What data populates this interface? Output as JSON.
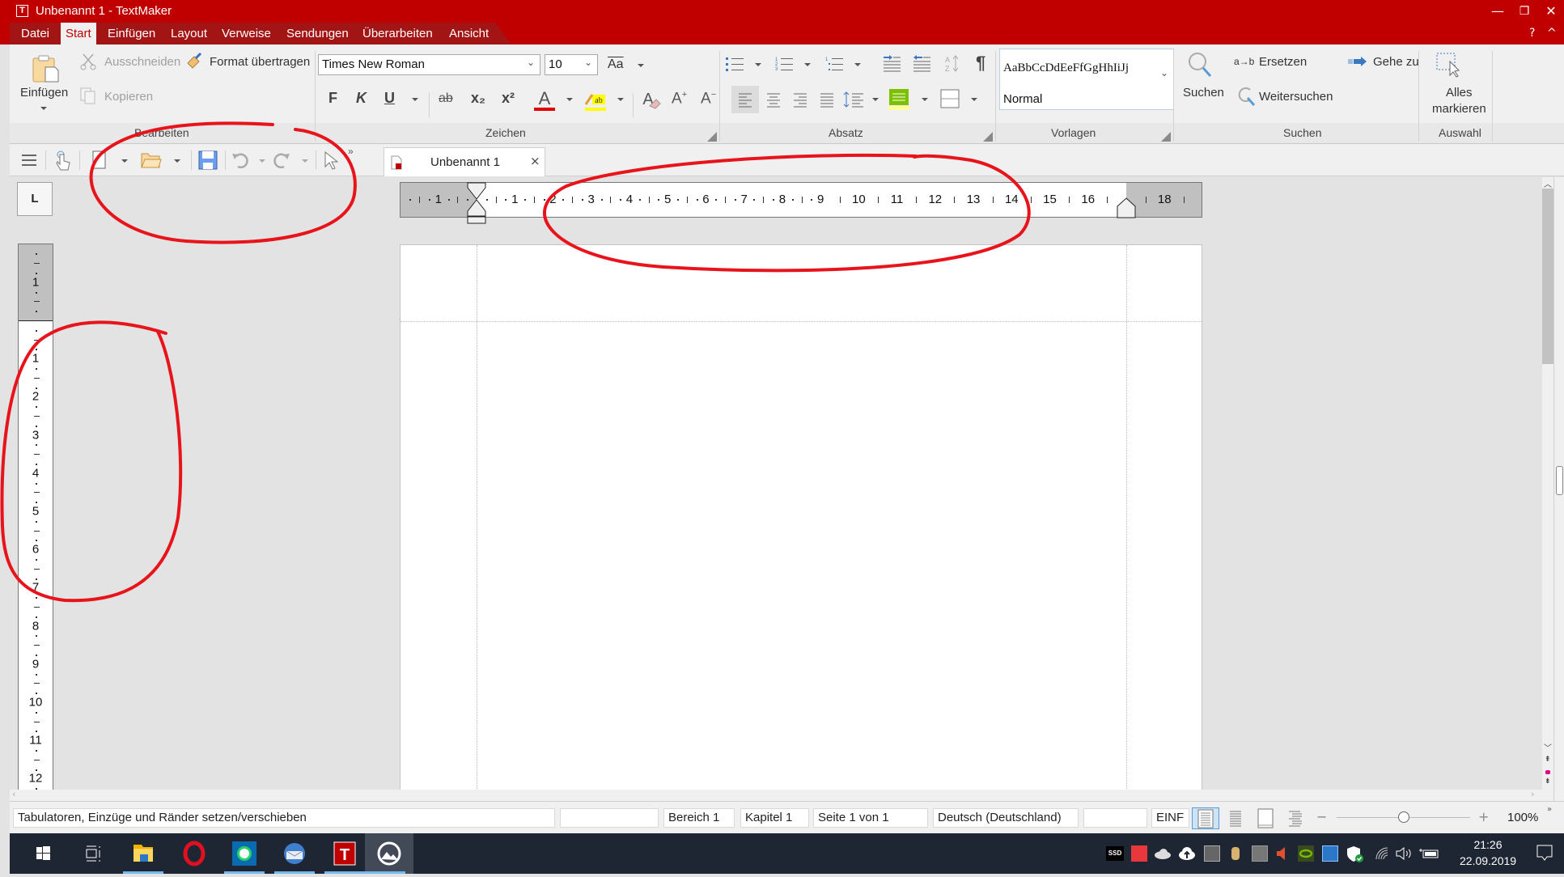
{
  "window": {
    "title": "Unbenannt 1 - TextMaker",
    "app_icon_letter": "T",
    "minimize": "—",
    "restore": "❐",
    "close": "✕",
    "help": "?",
    "collapse_ribbon": "^"
  },
  "menu": {
    "items": [
      {
        "label": "Datei"
      },
      {
        "label": "Start",
        "active": true
      },
      {
        "label": "Einfügen"
      },
      {
        "label": "Layout"
      },
      {
        "label": "Verweise"
      },
      {
        "label": "Sendungen"
      },
      {
        "label": "Überarbeiten"
      },
      {
        "label": "Ansicht"
      }
    ]
  },
  "ribbon": {
    "groups": {
      "bearbeiten": {
        "label": "Bearbeiten",
        "paste": "Einfügen",
        "cut": "Ausschneiden",
        "copy": "Kopieren",
        "format_painter": "Format übertragen"
      },
      "zeichen": {
        "label": "Zeichen",
        "font_name": "Times New Roman",
        "font_size": "10",
        "bold": "F",
        "italic": "K",
        "underline": "U",
        "strikethrough": "ab",
        "subscript": "x₂",
        "superscript": "x²",
        "font_color": "#e00000",
        "highlight_color": "#ffff00",
        "change_case": "Aa",
        "grow_font": "A",
        "shrink_font": "A"
      },
      "absatz": {
        "label": "Absatz",
        "active_alignment": "left",
        "shading_color": "#7dc000"
      },
      "vorlagen": {
        "label": "Vorlagen",
        "preview_text": "AaBbCcDdEeFfGgHhIiJj",
        "style_name": "Normal"
      },
      "suchen": {
        "label": "Suchen",
        "search": "Suchen",
        "replace_prefix": "a→b",
        "replace": "Ersetzen",
        "find_next": "Weitersuchen",
        "goto": "Gehe zu"
      },
      "auswahl": {
        "label": "Auswahl",
        "select_all_line1": "Alles",
        "select_all_line2": "markieren"
      }
    }
  },
  "quick_access": {
    "more": "»",
    "document_tab": "Unbenannt 1",
    "document_tab_close": "×"
  },
  "rulers": {
    "tabstop_type": "L",
    "horizontal_labels_left_margin": [
      "1"
    ],
    "horizontal_labels": [
      "1",
      "2",
      "3",
      "4",
      "5",
      "6",
      "7",
      "8",
      "9",
      "10",
      "11",
      "12",
      "13",
      "14",
      "15",
      "16"
    ],
    "horizontal_labels_right_margin": [
      "18"
    ],
    "vertical_labels_top_margin": [
      "1"
    ],
    "vertical_labels": [
      "1",
      "2",
      "3",
      "4",
      "5",
      "6",
      "7",
      "8",
      "9",
      "10",
      "11",
      "12"
    ]
  },
  "statusbar": {
    "hint": "Tabulatoren, Einzüge und Ränder setzen/verschieben",
    "empty1": "",
    "section": "Bereich 1",
    "chapter": "Kapitel 1",
    "page": "Seite 1 von 1",
    "language": "Deutsch (Deutschland)",
    "empty2": "",
    "insert_mode": "EINF",
    "zoom_minus": "−",
    "zoom_plus": "+",
    "zoom_level": "100%",
    "zoom_fraction": 0.5,
    "active_view": "normal"
  },
  "taskbar": {
    "apps": [
      {
        "name": "start"
      },
      {
        "name": "task-view"
      },
      {
        "name": "file-explorer",
        "running": true
      },
      {
        "name": "opera"
      },
      {
        "name": "whatsapp",
        "running": true
      },
      {
        "name": "thunderbird",
        "running": true
      },
      {
        "name": "textmaker",
        "running": true
      },
      {
        "name": "photos",
        "running": true,
        "active": true
      }
    ],
    "tray_ssd_label": "SSD",
    "time": "21:26",
    "date": "22.09.2019"
  },
  "annotations": {
    "color": "#e8141b"
  }
}
